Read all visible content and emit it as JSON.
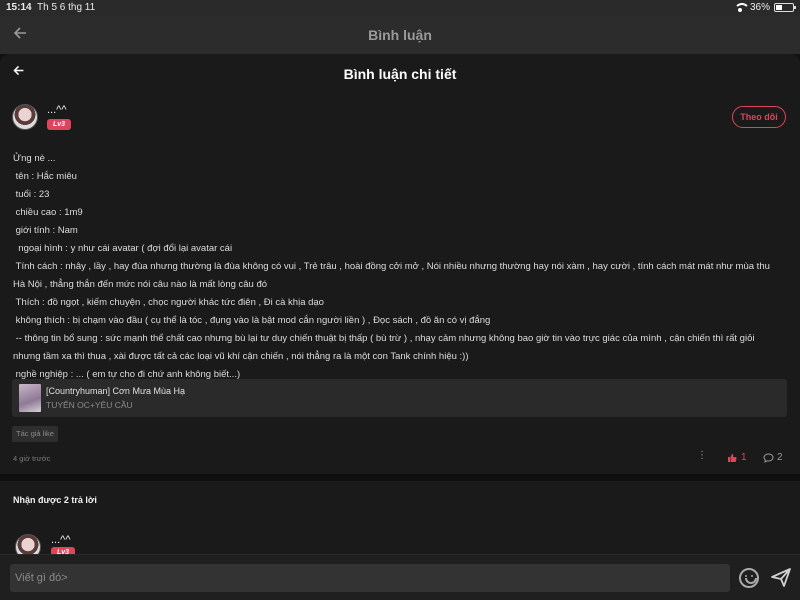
{
  "status_bar": {
    "time": "15:14",
    "date": "Th 5 6 thg 11",
    "battery": "36%",
    "battery_level": 0.36
  },
  "outer_header": {
    "title": "Bình luận"
  },
  "sheet": {
    "title": "Bình luận chi tiết"
  },
  "comment": {
    "username": "...^^",
    "level": "Lv3",
    "follow_label": "Theo dõi",
    "lines": [
      "Ửng nè ...",
      " tên : Hắc miêu",
      " tuổi : 23",
      " chiều cao : 1m9",
      " giới tính : Nam",
      "  ngoại hình : y như cái avatar ( đợi đổi lại avatar cái",
      " Tính cách : nhây , lầy , hay đùa nhưng thường là đùa không có vui , Trẻ trâu , hoài đồng cởi mở , Nói nhiều nhưng thường hay nói xàm , hay cười , tính cách mát mát như mùa thu Hà Nội , thẳng thắn đến mức nói câu nào là mất lòng câu đó",
      " Thích : đồ ngọt , kiếm chuyện , chọc người khác tức điên , Đi cà khịa dạo",
      " không thích : bị chạm vào đầu ( cụ thể là tóc , đụng vào là bật mod cắn người liền ) , Đọc sách , đồ ăn có vị đắng",
      " -- thông tin bổ sung : sức mạnh thể chất cao nhưng bù lại tư duy chiến thuật bị thấp ( bù trừ ) , nhạy cảm nhưng không bao giờ tin vào trực giác của mình , cận chiến thì rất giỏi nhưng tầm xa thì thua , xài được tất cả các loại vũ khí cận chiến , nói thẳng ra là một con Tank chính hiệu :))",
      " nghề nghiệp : ... ( em tự cho đi chứ anh không biết...)"
    ],
    "linked_story": {
      "title": "[Countryhuman] Cơn Mưa Mùa Hạ",
      "subtitle": "TUYỂN OC+YÊU CẦU"
    },
    "author_like": "Tác giả like",
    "time_ago": "4 giờ trước",
    "more": "⋮",
    "like_count": "1",
    "reply_count": "2"
  },
  "replies": {
    "heading": "Nhận được 2 trả lời",
    "items": [
      {
        "username": "...^^",
        "level": "Lv3"
      }
    ]
  },
  "composer": {
    "placeholder": "Viết gì đó>"
  },
  "colors": {
    "accent": "#e0435c",
    "background": "#1a1a1a"
  },
  "icons": [
    "back-arrow-icon",
    "wifi-icon",
    "battery-icon",
    "more-icon",
    "thumbs-up-icon",
    "comment-bubble-icon",
    "emoji-icon",
    "send-icon"
  ]
}
